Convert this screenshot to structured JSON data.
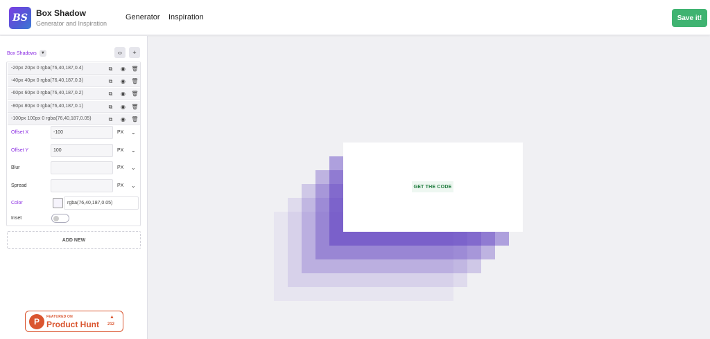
{
  "header": {
    "logo_text": "BS",
    "title": "Box Shadow",
    "subtitle": "Generator and Inspiration",
    "nav": [
      {
        "label": "Generator"
      },
      {
        "label": "Inspiration"
      }
    ],
    "save_label": "Save it!"
  },
  "sidebar": {
    "section_title": "Box Shadows",
    "shadows": [
      {
        "text": "-20px 20px 0 rgba(76,40,187,0.4)"
      },
      {
        "text": "-40px 40px 0 rgba(76,40,187,0.3)"
      },
      {
        "text": "-60px 60px 0 rgba(76,40,187,0.2)"
      },
      {
        "text": "-80px 80px 0 rgba(76,40,187,0.1)"
      },
      {
        "text": "-100px 100px 0 rgba(76,40,187,0.05)"
      }
    ],
    "fields": {
      "offset_x": {
        "label": "Offset X",
        "value": "-100",
        "unit": "PX"
      },
      "offset_y": {
        "label": "Offset Y",
        "value": "100",
        "unit": "PX"
      },
      "blur": {
        "label": "Blur",
        "value": "",
        "unit": "PX"
      },
      "spread": {
        "label": "Spread",
        "value": "",
        "unit": "PX"
      },
      "color": {
        "label": "Color",
        "value": "rgba(76,40,187,0.05)"
      },
      "inset": {
        "label": "Inset",
        "on": false
      }
    },
    "add_new_label": "ADD NEW"
  },
  "product_hunt": {
    "featured": "FEATURED ON",
    "name": "Product Hunt",
    "count": "212"
  },
  "preview": {
    "button_label": "GET THE CODE"
  },
  "colors": {
    "accent_purple": "#8a2be2",
    "save_green": "#3fb371",
    "shadow_color": "#4c28bb",
    "product_hunt": "#da552f"
  }
}
